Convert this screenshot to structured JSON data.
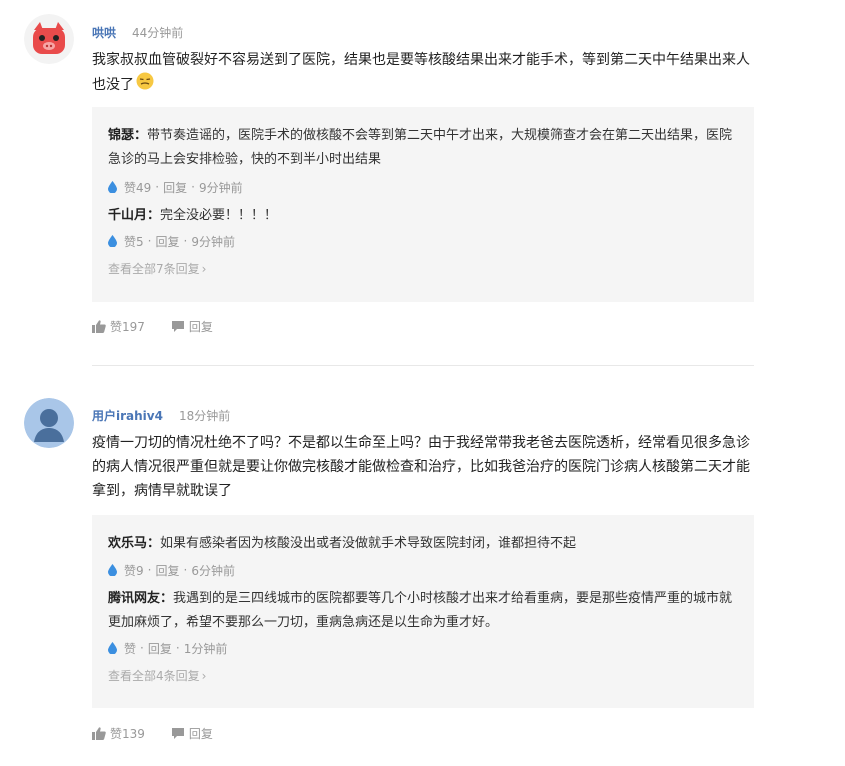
{
  "comments": [
    {
      "username": "哄哄",
      "time": "44分钟前",
      "text": "我家叔叔血管破裂好不容易送到了医院，结果也是要等核酸结果出来才能手术，等到第二天中午结果出来人也没了",
      "emoji": "sad-face-emoji",
      "replies": [
        {
          "name": "锦瑟：",
          "text": "带节奏造谣的，医院手术的做核酸不会等到第二天中午才出来，大规模筛查才会在第二天出结果，医院急诊的马上会安排检验，快的不到半小时出结果",
          "likes": "赞49",
          "reply_label": "回复",
          "time": "9分钟前"
        },
        {
          "name": "千山月：",
          "text": "完全没必要！！！！",
          "likes": "赞5",
          "reply_label": "回复",
          "time": "9分钟前"
        }
      ],
      "view_all": "查看全部7条回复",
      "like_count": "赞197",
      "reply_label": "回复"
    },
    {
      "username": "用户irahiv4",
      "time": "18分钟前",
      "text": "疫情一刀切的情况杜绝不了吗？不是都以生命至上吗？由于我经常带我老爸去医院透析，经常看见很多急诊的病人情况很严重但就是要让你做完核酸才能做检查和治疗，比如我爸治疗的医院门诊病人核酸第二天才能拿到，病情早就耽误了",
      "replies": [
        {
          "name": "欢乐马：",
          "text": "如果有感染者因为核酸没出或者没做就手术导致医院封闭，谁都担待不起",
          "likes": "赞9",
          "reply_label": "回复",
          "time": "6分钟前"
        },
        {
          "name": "腾讯网友：",
          "text": "我遇到的是三四线城市的医院都要等几个小时核酸才出来才给看重病，要是那些疫情严重的城市就更加麻烦了，希望不要那么一刀切，重病急病还是以生命为重才好。",
          "likes": "赞",
          "reply_label": "回复",
          "time": "1分钟前"
        }
      ],
      "view_all": "查看全部4条回复",
      "like_count": "赞139",
      "reply_label": "回复"
    }
  ],
  "colors": {
    "username": "#4a76b6",
    "drop": "#3b8fe0",
    "reply_bg": "#f5f5f5",
    "avatar1_bg": "#e94b4b",
    "avatar2_bg": "#a9c6e8"
  },
  "icons": {
    "like": "thumbs-up-icon",
    "reply": "speech-bubble-icon",
    "reply_like": "water-drop-icon",
    "view_all": "chevron-right-icon"
  }
}
